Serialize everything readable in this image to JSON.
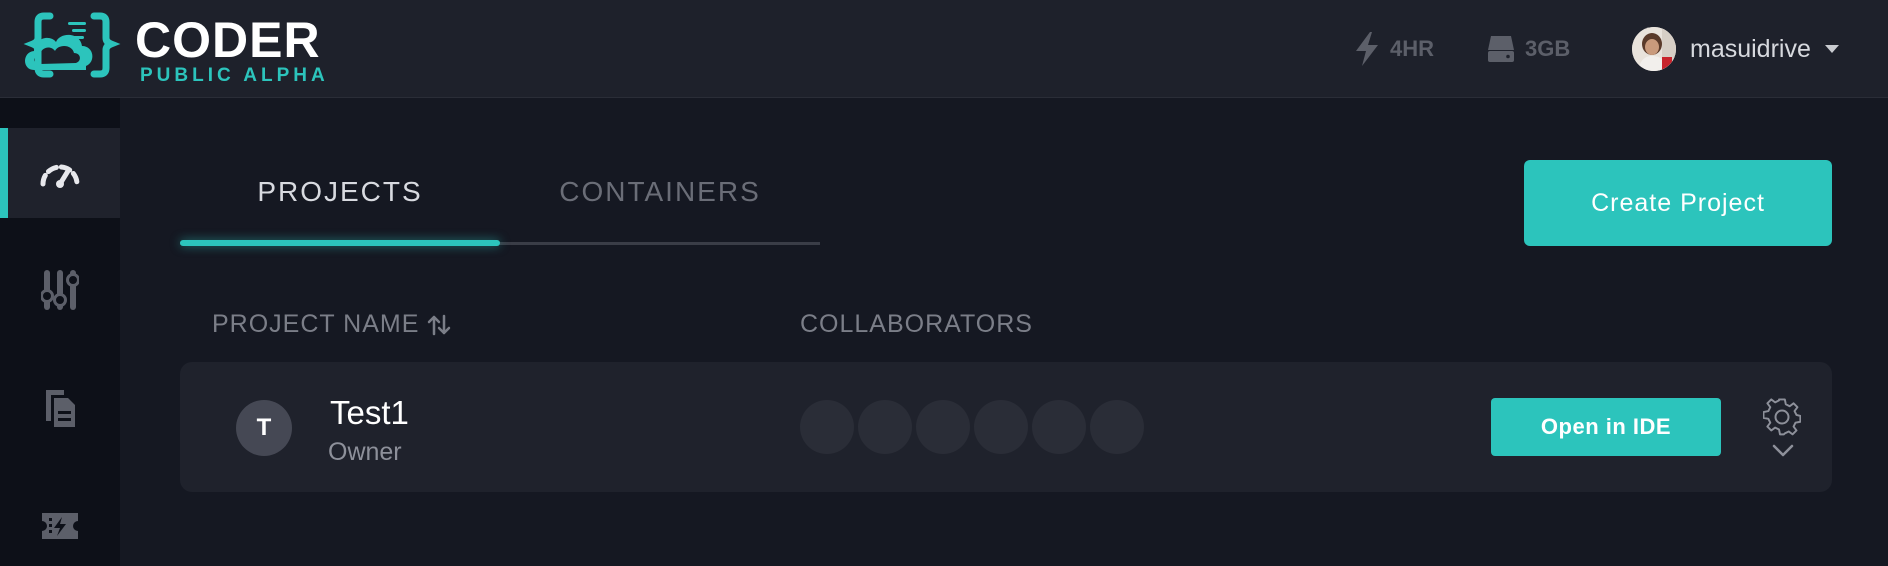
{
  "brand": {
    "name": "CODER",
    "tagline": "PUBLIC ALPHA",
    "accent_color": "#2cc4bc",
    "logo_icon": "cloud-braces-logo"
  },
  "topbar": {
    "time_quota": {
      "icon": "lightning-icon",
      "label": "4HR"
    },
    "disk_quota": {
      "icon": "drive-icon",
      "label": "3GB"
    },
    "user": {
      "avatar": "user-avatar-photo",
      "name": "masuidrive",
      "menu_icon": "caret-down-icon"
    }
  },
  "sidebar": {
    "items": [
      {
        "icon": "dashboard-gauge-icon",
        "active": true
      },
      {
        "icon": "sliders-icon",
        "active": false
      },
      {
        "icon": "documents-icon",
        "active": false
      },
      {
        "icon": "ticket-lightning-icon",
        "active": false
      }
    ]
  },
  "tabs": [
    {
      "label": "PROJECTS",
      "active": true
    },
    {
      "label": "CONTAINERS",
      "active": false
    }
  ],
  "create_button": "Create Project",
  "table": {
    "columns": {
      "name": "PROJECT NAME",
      "name_sort_icon": "sort-arrows-icon",
      "collaborators": "COLLABORATORS"
    },
    "rows": [
      {
        "initial": "T",
        "name": "Test1",
        "role": "Owner",
        "collaborator_slots": 6,
        "open_button": "Open in IDE",
        "settings_icon": "gear-icon",
        "expand_icon": "chevron-down-icon"
      }
    ]
  }
}
